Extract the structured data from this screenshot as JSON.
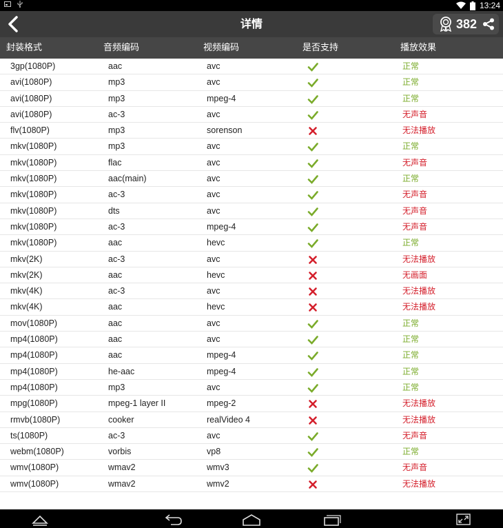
{
  "status": {
    "time": "13:24"
  },
  "header": {
    "title": "详情",
    "score": "382"
  },
  "columns": [
    "封装格式",
    "音频编码",
    "视频编码",
    "是否支持",
    "播放效果"
  ],
  "colors": {
    "ok": "#7aab2a",
    "bad": "#d4202c",
    "header_bg": "#3a3a3a"
  },
  "rows": [
    {
      "format": "3gp(1080P)",
      "audio": "aac",
      "video": "avc",
      "supported": true,
      "effect": "正常",
      "effect_type": "ok"
    },
    {
      "format": "avi(1080P)",
      "audio": "mp3",
      "video": "avc",
      "supported": true,
      "effect": "正常",
      "effect_type": "ok"
    },
    {
      "format": "avi(1080P)",
      "audio": "mp3",
      "video": "mpeg-4",
      "supported": true,
      "effect": "正常",
      "effect_type": "ok"
    },
    {
      "format": "avi(1080P)",
      "audio": "ac-3",
      "video": "avc",
      "supported": true,
      "effect": "无声音",
      "effect_type": "bad"
    },
    {
      "format": "flv(1080P)",
      "audio": "mp3",
      "video": "sorenson",
      "supported": false,
      "effect": "无法播放",
      "effect_type": "bad"
    },
    {
      "format": "mkv(1080P)",
      "audio": "mp3",
      "video": "avc",
      "supported": true,
      "effect": "正常",
      "effect_type": "ok"
    },
    {
      "format": "mkv(1080P)",
      "audio": "flac",
      "video": "avc",
      "supported": true,
      "effect": "无声音",
      "effect_type": "bad"
    },
    {
      "format": "mkv(1080P)",
      "audio": "aac(main)",
      "video": "avc",
      "supported": true,
      "effect": "正常",
      "effect_type": "ok"
    },
    {
      "format": "mkv(1080P)",
      "audio": "ac-3",
      "video": "avc",
      "supported": true,
      "effect": "无声音",
      "effect_type": "bad"
    },
    {
      "format": "mkv(1080P)",
      "audio": "dts",
      "video": "avc",
      "supported": true,
      "effect": "无声音",
      "effect_type": "bad"
    },
    {
      "format": "mkv(1080P)",
      "audio": "ac-3",
      "video": "mpeg-4",
      "supported": true,
      "effect": "无声音",
      "effect_type": "bad"
    },
    {
      "format": "mkv(1080P)",
      "audio": "aac",
      "video": "hevc",
      "supported": true,
      "effect": "正常",
      "effect_type": "ok"
    },
    {
      "format": "mkv(2K)",
      "audio": "ac-3",
      "video": "avc",
      "supported": false,
      "effect": "无法播放",
      "effect_type": "bad"
    },
    {
      "format": "mkv(2K)",
      "audio": "aac",
      "video": "hevc",
      "supported": false,
      "effect": "无画面",
      "effect_type": "bad"
    },
    {
      "format": "mkv(4K)",
      "audio": "ac-3",
      "video": "avc",
      "supported": false,
      "effect": "无法播放",
      "effect_type": "bad"
    },
    {
      "format": "mkv(4K)",
      "audio": "aac",
      "video": "hevc",
      "supported": false,
      "effect": "无法播放",
      "effect_type": "bad"
    },
    {
      "format": "mov(1080P)",
      "audio": "aac",
      "video": "avc",
      "supported": true,
      "effect": "正常",
      "effect_type": "ok"
    },
    {
      "format": "mp4(1080P)",
      "audio": "aac",
      "video": "avc",
      "supported": true,
      "effect": "正常",
      "effect_type": "ok"
    },
    {
      "format": "mp4(1080P)",
      "audio": "aac",
      "video": "mpeg-4",
      "supported": true,
      "effect": "正常",
      "effect_type": "ok"
    },
    {
      "format": "mp4(1080P)",
      "audio": "he-aac",
      "video": "mpeg-4",
      "supported": true,
      "effect": "正常",
      "effect_type": "ok"
    },
    {
      "format": "mp4(1080P)",
      "audio": "mp3",
      "video": "avc",
      "supported": true,
      "effect": "正常",
      "effect_type": "ok"
    },
    {
      "format": "mpg(1080P)",
      "audio": "mpeg-1 layer II",
      "video": "mpeg-2",
      "supported": false,
      "effect": "无法播放",
      "effect_type": "bad"
    },
    {
      "format": "rmvb(1080P)",
      "audio": "cooker",
      "video": "realVideo 4",
      "supported": false,
      "effect": "无法播放",
      "effect_type": "bad"
    },
    {
      "format": "ts(1080P)",
      "audio": "ac-3",
      "video": "avc",
      "supported": true,
      "effect": "无声音",
      "effect_type": "bad"
    },
    {
      "format": "webm(1080P)",
      "audio": "vorbis",
      "video": "vp8",
      "supported": true,
      "effect": "正常",
      "effect_type": "ok"
    },
    {
      "format": "wmv(1080P)",
      "audio": "wmav2",
      "video": "wmv3",
      "supported": true,
      "effect": "无声音",
      "effect_type": "bad"
    },
    {
      "format": "wmv(1080P)",
      "audio": "wmav2",
      "video": "wmv2",
      "supported": false,
      "effect": "无法播放",
      "effect_type": "bad"
    }
  ],
  "icons": {
    "supported": "check-icon",
    "unsupported": "cross-icon"
  }
}
